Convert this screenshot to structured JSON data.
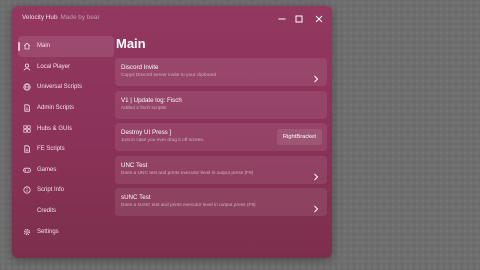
{
  "window": {
    "title": "Velocity Hub",
    "subtitle": "Made by bear"
  },
  "sidebar": {
    "items": [
      {
        "label": "Main",
        "icon": "home-icon",
        "active": true
      },
      {
        "label": "Local Player",
        "icon": "user-icon"
      },
      {
        "label": "Universal Scripts",
        "icon": "globe-icon"
      },
      {
        "label": "Admin Scripts",
        "icon": "document-icon"
      },
      {
        "label": "Hubs & GUIs",
        "icon": "grid-icon"
      },
      {
        "label": "FE Scripts",
        "icon": "document-icon"
      },
      {
        "label": "Games",
        "icon": "gamepad-icon"
      },
      {
        "label": "Script Info",
        "icon": "info-icon"
      },
      {
        "label": "Credits",
        "icon": ""
      },
      {
        "label": "Settings",
        "icon": "gear-icon"
      }
    ]
  },
  "main": {
    "title": "Main",
    "cards": [
      {
        "title": "Discord Invite",
        "desc": "Copys Discord server invite to your clipboard",
        "action": "chevron"
      },
      {
        "title": "V1 | Update log: Fisch",
        "desc": "Added 2 fisch scripts!",
        "action": "none"
      },
      {
        "title": "Destroy UI Press ]",
        "desc": "Just in case you ever drag it off screen.",
        "action": "keybind",
        "key": "RightBracket"
      },
      {
        "title": "UNC Test",
        "desc": "Does a UNC test and prints executor level in output press (F9)",
        "action": "chevron"
      },
      {
        "title": "sUNC Test",
        "desc": "Does a sUNC test and prints executor level in output press (F9)",
        "action": "chevron"
      }
    ]
  },
  "colors": {
    "window_bg": "#8a3258",
    "accent": "#f0c2d4",
    "desc_text": "#d6aec0"
  }
}
